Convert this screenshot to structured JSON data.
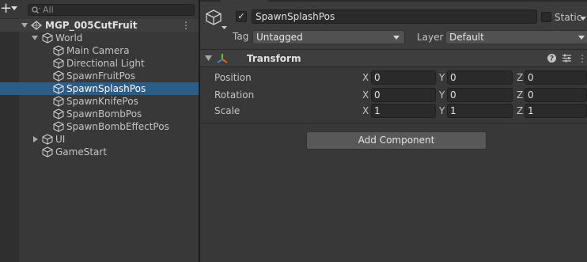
{
  "hierarchy": {
    "add_button": "+",
    "search": {
      "placeholder": "All",
      "value": ""
    },
    "scene": {
      "name": "MGP_005CutFruit",
      "menu": "⋮"
    },
    "items": [
      {
        "label": "World"
      },
      {
        "label": "Main Camera"
      },
      {
        "label": "Directional Light"
      },
      {
        "label": "SpawnFruitPos"
      },
      {
        "label": "SpawnSplashPos",
        "selected": true
      },
      {
        "label": "SpawnKnifePos"
      },
      {
        "label": "SpawnBombPos"
      },
      {
        "label": "SpawnBombEffectPos"
      },
      {
        "label": "UI"
      },
      {
        "label": "GameStart"
      }
    ]
  },
  "inspector": {
    "gameobject": {
      "active": true,
      "active_check": "✓",
      "name": "SpawnSplashPos",
      "static_label": "Static",
      "static": false,
      "tag_label": "Tag",
      "tag_value": "Untagged",
      "layer_label": "Layer",
      "layer_value": "Default"
    },
    "transform": {
      "title": "Transform",
      "menu": "⋮",
      "rows": [
        {
          "label": "Position",
          "x": "0",
          "y": "0",
          "z": "0"
        },
        {
          "label": "Rotation",
          "x": "0",
          "y": "0",
          "z": "0"
        },
        {
          "label": "Scale",
          "x": "1",
          "y": "1",
          "z": "1"
        }
      ],
      "axis": {
        "x": "X",
        "y": "Y",
        "z": "Z"
      }
    },
    "add_component": "Add Component"
  },
  "colors": {
    "selection": "#2c5d87",
    "panel": "#383838",
    "field": "#2a2a2a"
  }
}
